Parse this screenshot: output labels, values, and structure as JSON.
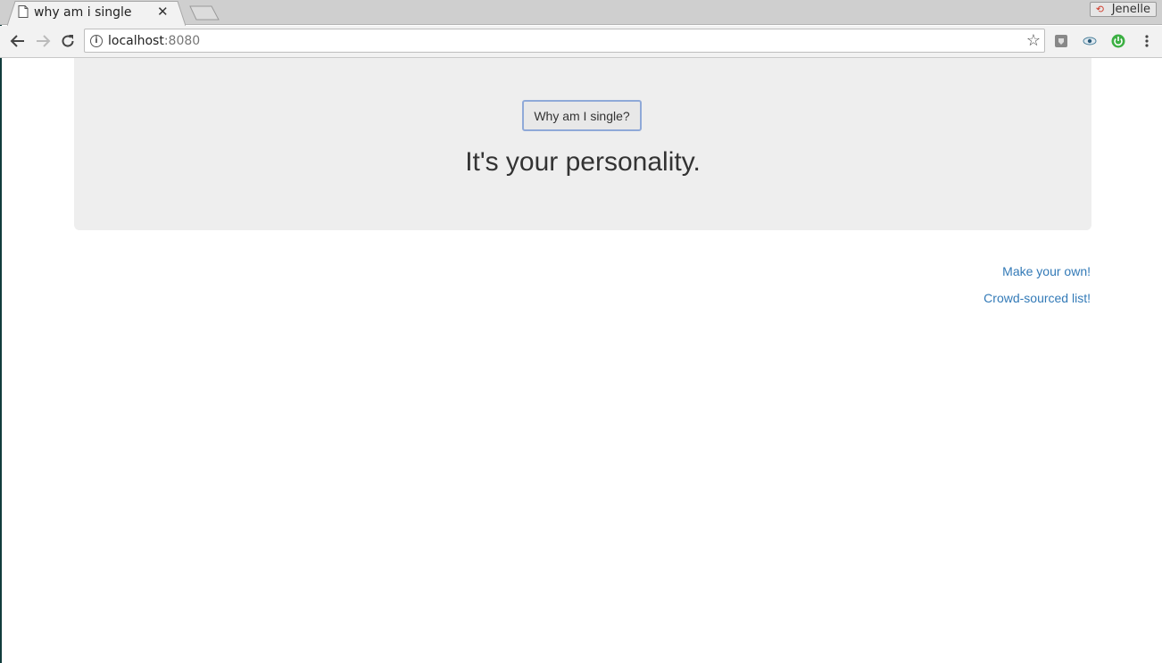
{
  "browser": {
    "tab_title": "why am i single",
    "profile_name": "Jenelle",
    "url_host": "localhost",
    "url_port": ":8080"
  },
  "page": {
    "button_label": "Why am I single?",
    "answer": "It's your personality.",
    "links": [
      "Make your own!",
      "Crowd-sourced list!"
    ]
  },
  "colors": {
    "link": "#337ab7",
    "jumbotron_bg": "#eeeeee",
    "button_border": "#8fa9d8"
  }
}
